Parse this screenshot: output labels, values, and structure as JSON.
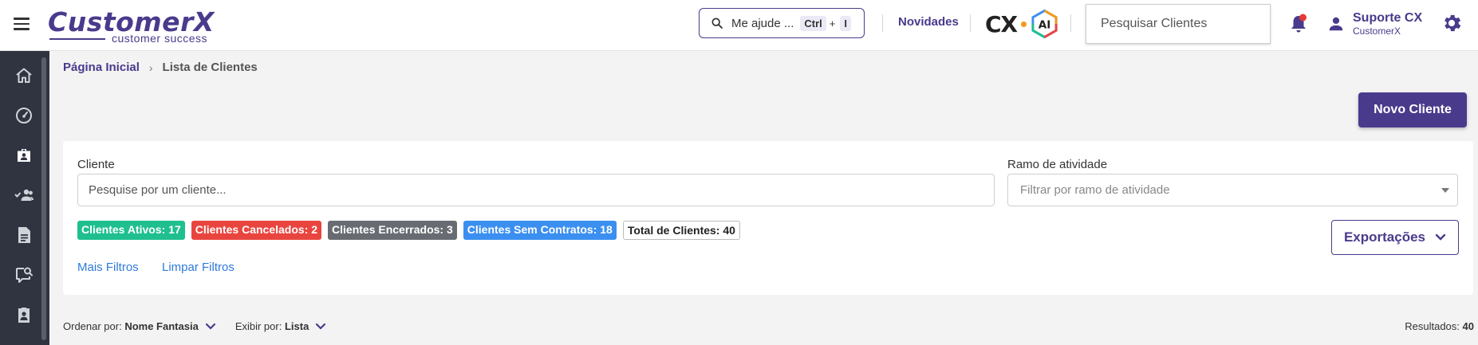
{
  "header": {
    "logo_main": "CustomerX",
    "logo_sub": "customer success",
    "help_text": "Me ajude ...",
    "help_key1": "Ctrl",
    "help_plus": "+",
    "help_key2": "I",
    "novidades": "Novidades",
    "cx_text": "CX",
    "ai_text": "AI",
    "search_placeholder": "Pesquisar Clientes",
    "user_name": "Suporte CX",
    "user_org": "CustomerX"
  },
  "colors": {
    "brand": "#4a3a8c",
    "notification_dot": "#e53935",
    "sidebar_bg": "#2f3440",
    "link": "#2f7ad8"
  },
  "sidebar": {
    "items": [
      {
        "icon": "home-icon"
      },
      {
        "icon": "dashboard-gauge-icon"
      },
      {
        "icon": "clients-briefcase-icon"
      },
      {
        "icon": "team-check-icon"
      },
      {
        "icon": "document-icon"
      },
      {
        "icon": "chat-search-icon"
      },
      {
        "icon": "clipboard-user-icon"
      }
    ]
  },
  "breadcrumb": {
    "home": "Página Inicial",
    "current": "Lista de Clientes"
  },
  "actions": {
    "novo_cliente": "Novo Cliente",
    "exportacoes": "Exportações"
  },
  "filters": {
    "cliente_label": "Cliente",
    "cliente_placeholder": "Pesquise por um cliente...",
    "ramo_label": "Ramo de atividade",
    "ramo_placeholder": "Filtrar por ramo de atividade",
    "mais_filtros": "Mais Filtros",
    "limpar_filtros": "Limpar Filtros"
  },
  "badges": [
    {
      "label": "Clientes Ativos: 17",
      "color": "#1fbf8f"
    },
    {
      "label": "Clientes Cancelados: 2",
      "color": "#e9453f"
    },
    {
      "label": "Clientes Encerrados: 3",
      "color": "#686c72"
    },
    {
      "label": "Clientes Sem Contratos: 18",
      "color": "#3b8ff0"
    },
    {
      "label": "Total de Clientes: 40",
      "color": "#ffffff"
    }
  ],
  "sort": {
    "order_label": "Ordenar por:",
    "order_value": "Nome Fantasia",
    "view_label": "Exibir por:",
    "view_value": "Lista",
    "results_label": "Resultados:",
    "results_value": "40"
  }
}
